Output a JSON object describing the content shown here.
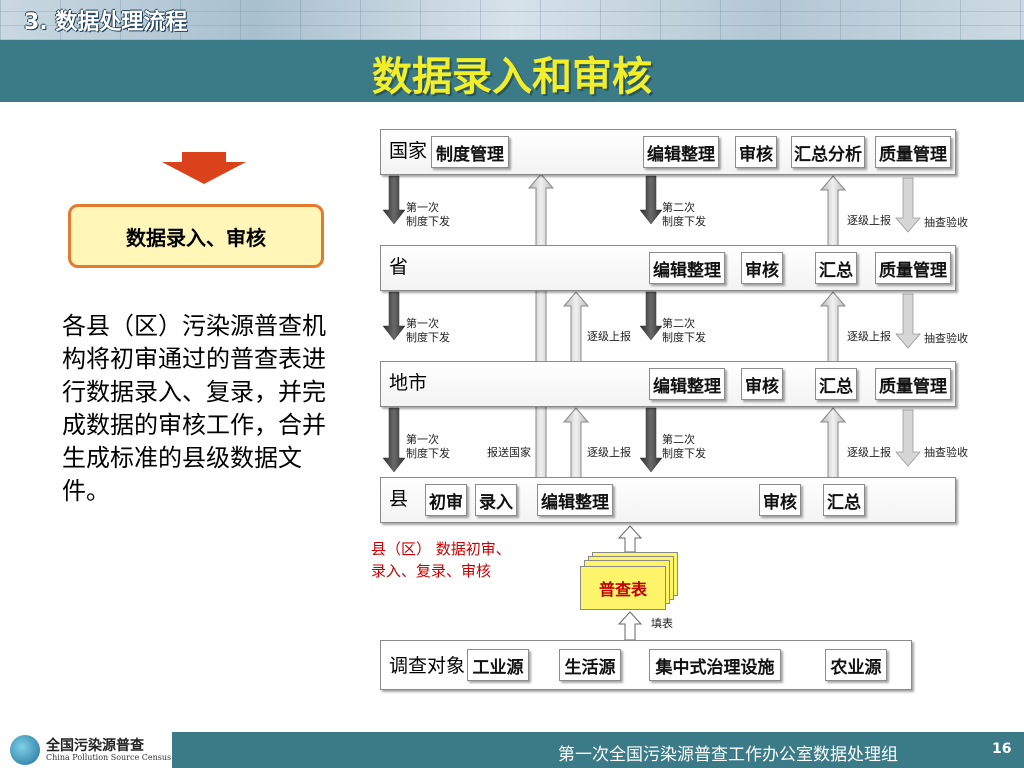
{
  "header": {
    "section_label": "3. 数据处理流程",
    "title": "数据录入和审核"
  },
  "left_panel": {
    "box_label": "数据录入、审核",
    "description": "各县（区）污染源普查机构将初审通过的普查表进行数据录入、复录，并完成数据的审核工作，合并生成标准的县级数据文件。"
  },
  "diagram": {
    "levels": [
      {
        "name": "国家",
        "tasks": [
          "制度管理",
          "编辑整理",
          "审核",
          "汇总分析",
          "质量管理"
        ]
      },
      {
        "name": "省",
        "tasks": [
          "编辑整理",
          "审核",
          "汇总",
          "质量管理"
        ]
      },
      {
        "name": "地市",
        "tasks": [
          "编辑整理",
          "审核",
          "汇总",
          "质量管理"
        ]
      },
      {
        "name": "县",
        "tasks": [
          "初审",
          "录入",
          "编辑整理",
          "审核",
          "汇总"
        ]
      }
    ],
    "arrow_labels": {
      "first_issue": "第一次\n制度下发",
      "second_issue": "第二次\n制度下发",
      "report_up": "逐级上报",
      "sample_check": "抽查验收",
      "send_national": "报送国家",
      "fill_form": "填表"
    },
    "county_note": "县（区） 数据初审、\n录入、复录、审核",
    "form_label": "普查表",
    "survey": {
      "name": "调查对象",
      "items": [
        "工业源",
        "生活源",
        "集中式治理设施",
        "农业源"
      ]
    }
  },
  "footer": {
    "logo_cn": "全国污染源普查",
    "logo_en": "China Pollution Source Census",
    "text": "第一次全国污染源普查工作办公室数据处理组",
    "page": "16"
  },
  "colors": {
    "header": "#3b7b87",
    "title": "#f2ee2a",
    "box_border": "#e47a2c",
    "box_fill": "#fff6b8",
    "red_arrow": "#d9421b",
    "form_fill": "#fdf46a",
    "red_text": "#cc0000"
  }
}
